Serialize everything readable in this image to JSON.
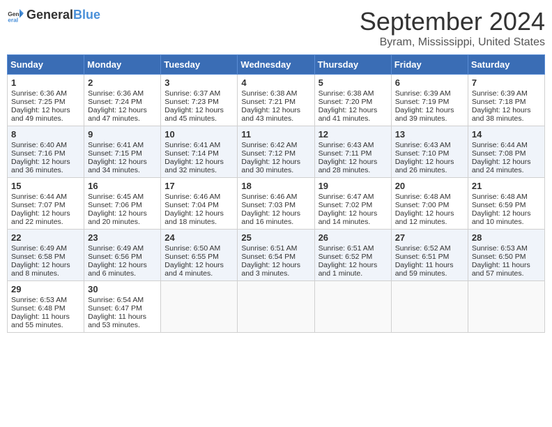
{
  "header": {
    "logo_general": "General",
    "logo_blue": "Blue",
    "month_title": "September 2024",
    "location": "Byram, Mississippi, United States"
  },
  "days_of_week": [
    "Sunday",
    "Monday",
    "Tuesday",
    "Wednesday",
    "Thursday",
    "Friday",
    "Saturday"
  ],
  "weeks": [
    [
      {
        "day": "1",
        "sunrise": "6:36 AM",
        "sunset": "7:25 PM",
        "daylight": "12 hours and 49 minutes."
      },
      {
        "day": "2",
        "sunrise": "6:36 AM",
        "sunset": "7:24 PM",
        "daylight": "12 hours and 47 minutes."
      },
      {
        "day": "3",
        "sunrise": "6:37 AM",
        "sunset": "7:23 PM",
        "daylight": "12 hours and 45 minutes."
      },
      {
        "day": "4",
        "sunrise": "6:38 AM",
        "sunset": "7:21 PM",
        "daylight": "12 hours and 43 minutes."
      },
      {
        "day": "5",
        "sunrise": "6:38 AM",
        "sunset": "7:20 PM",
        "daylight": "12 hours and 41 minutes."
      },
      {
        "day": "6",
        "sunrise": "6:39 AM",
        "sunset": "7:19 PM",
        "daylight": "12 hours and 39 minutes."
      },
      {
        "day": "7",
        "sunrise": "6:39 AM",
        "sunset": "7:18 PM",
        "daylight": "12 hours and 38 minutes."
      }
    ],
    [
      {
        "day": "8",
        "sunrise": "6:40 AM",
        "sunset": "7:16 PM",
        "daylight": "12 hours and 36 minutes."
      },
      {
        "day": "9",
        "sunrise": "6:41 AM",
        "sunset": "7:15 PM",
        "daylight": "12 hours and 34 minutes."
      },
      {
        "day": "10",
        "sunrise": "6:41 AM",
        "sunset": "7:14 PM",
        "daylight": "12 hours and 32 minutes."
      },
      {
        "day": "11",
        "sunrise": "6:42 AM",
        "sunset": "7:12 PM",
        "daylight": "12 hours and 30 minutes."
      },
      {
        "day": "12",
        "sunrise": "6:43 AM",
        "sunset": "7:11 PM",
        "daylight": "12 hours and 28 minutes."
      },
      {
        "day": "13",
        "sunrise": "6:43 AM",
        "sunset": "7:10 PM",
        "daylight": "12 hours and 26 minutes."
      },
      {
        "day": "14",
        "sunrise": "6:44 AM",
        "sunset": "7:08 PM",
        "daylight": "12 hours and 24 minutes."
      }
    ],
    [
      {
        "day": "15",
        "sunrise": "6:44 AM",
        "sunset": "7:07 PM",
        "daylight": "12 hours and 22 minutes."
      },
      {
        "day": "16",
        "sunrise": "6:45 AM",
        "sunset": "7:06 PM",
        "daylight": "12 hours and 20 minutes."
      },
      {
        "day": "17",
        "sunrise": "6:46 AM",
        "sunset": "7:04 PM",
        "daylight": "12 hours and 18 minutes."
      },
      {
        "day": "18",
        "sunrise": "6:46 AM",
        "sunset": "7:03 PM",
        "daylight": "12 hours and 16 minutes."
      },
      {
        "day": "19",
        "sunrise": "6:47 AM",
        "sunset": "7:02 PM",
        "daylight": "12 hours and 14 minutes."
      },
      {
        "day": "20",
        "sunrise": "6:48 AM",
        "sunset": "7:00 PM",
        "daylight": "12 hours and 12 minutes."
      },
      {
        "day": "21",
        "sunrise": "6:48 AM",
        "sunset": "6:59 PM",
        "daylight": "12 hours and 10 minutes."
      }
    ],
    [
      {
        "day": "22",
        "sunrise": "6:49 AM",
        "sunset": "6:58 PM",
        "daylight": "12 hours and 8 minutes."
      },
      {
        "day": "23",
        "sunrise": "6:49 AM",
        "sunset": "6:56 PM",
        "daylight": "12 hours and 6 minutes."
      },
      {
        "day": "24",
        "sunrise": "6:50 AM",
        "sunset": "6:55 PM",
        "daylight": "12 hours and 4 minutes."
      },
      {
        "day": "25",
        "sunrise": "6:51 AM",
        "sunset": "6:54 PM",
        "daylight": "12 hours and 3 minutes."
      },
      {
        "day": "26",
        "sunrise": "6:51 AM",
        "sunset": "6:52 PM",
        "daylight": "12 hours and 1 minute."
      },
      {
        "day": "27",
        "sunrise": "6:52 AM",
        "sunset": "6:51 PM",
        "daylight": "11 hours and 59 minutes."
      },
      {
        "day": "28",
        "sunrise": "6:53 AM",
        "sunset": "6:50 PM",
        "daylight": "11 hours and 57 minutes."
      }
    ],
    [
      {
        "day": "29",
        "sunrise": "6:53 AM",
        "sunset": "6:48 PM",
        "daylight": "11 hours and 55 minutes."
      },
      {
        "day": "30",
        "sunrise": "6:54 AM",
        "sunset": "6:47 PM",
        "daylight": "11 hours and 53 minutes."
      },
      null,
      null,
      null,
      null,
      null
    ]
  ]
}
